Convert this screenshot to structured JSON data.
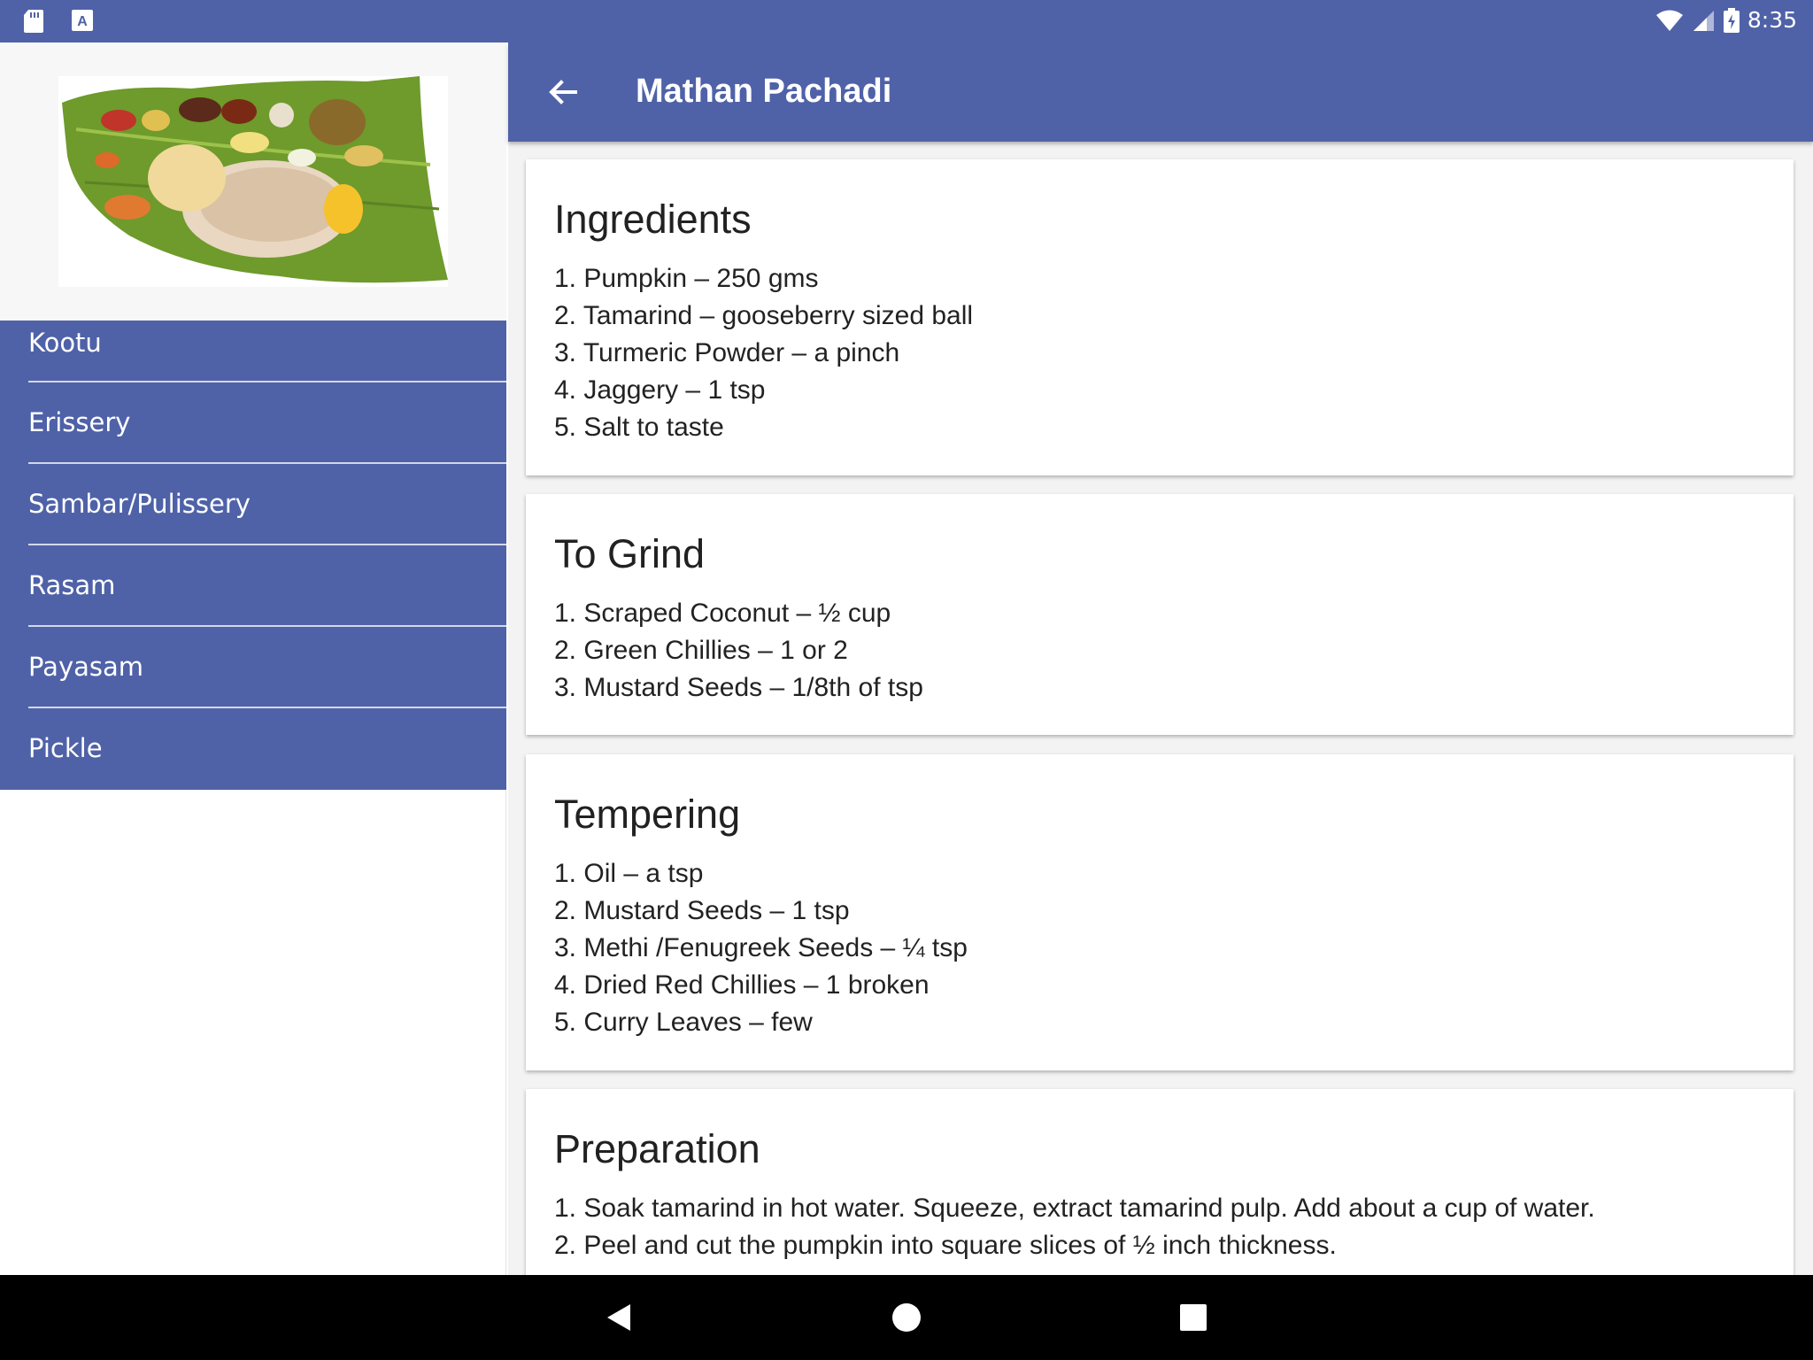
{
  "status_bar": {
    "time": "8:35",
    "icons": [
      "sd-card-icon",
      "keyboard-a-icon",
      "wifi-icon",
      "cell-signal-icon",
      "battery-charging-icon"
    ]
  },
  "drawer": {
    "header_image": "kerala-sadya-banana-leaf-meal",
    "items": [
      {
        "label": "Kootu"
      },
      {
        "label": "Erissery"
      },
      {
        "label": "Sambar/Pulissery"
      },
      {
        "label": "Rasam"
      },
      {
        "label": "Payasam"
      },
      {
        "label": "Pickle"
      }
    ]
  },
  "app_bar": {
    "title": "Mathan Pachadi",
    "back_icon": "arrow-back-icon"
  },
  "sections": [
    {
      "heading": "Ingredients",
      "lines": [
        "1. Pumpkin – 250 gms",
        "2. Tamarind – gooseberry sized ball",
        "3. Turmeric Powder – a pinch",
        "4. Jaggery – 1 tsp",
        "5. Salt to taste"
      ]
    },
    {
      "heading": "To Grind",
      "lines": [
        "1. Scraped Coconut – ½ cup",
        "2. Green Chillies – 1 or 2",
        "3. Mustard Seeds – 1/8th of tsp"
      ]
    },
    {
      "heading": "Tempering",
      "lines": [
        "1. Oil – a tsp",
        "2. Mustard Seeds – 1 tsp",
        "3. Methi /Fenugreek Seeds – ¼ tsp",
        "4. Dried Red Chillies – 1 broken",
        "5. Curry Leaves – few"
      ]
    },
    {
      "heading": "Preparation",
      "lines": [
        "1. Soak tamarind in hot water. Squeeze, extract tamarind pulp. Add about a cup of water.",
        "2. Peel and cut the pumpkin into square slices of ½ inch thickness."
      ]
    }
  ],
  "nav_bar": {
    "buttons": [
      "back-triangle-icon",
      "home-circle-icon",
      "recents-square-icon"
    ]
  },
  "colors": {
    "primary": "#4f62a8",
    "background": "#f3f3f3",
    "card": "#ffffff"
  }
}
